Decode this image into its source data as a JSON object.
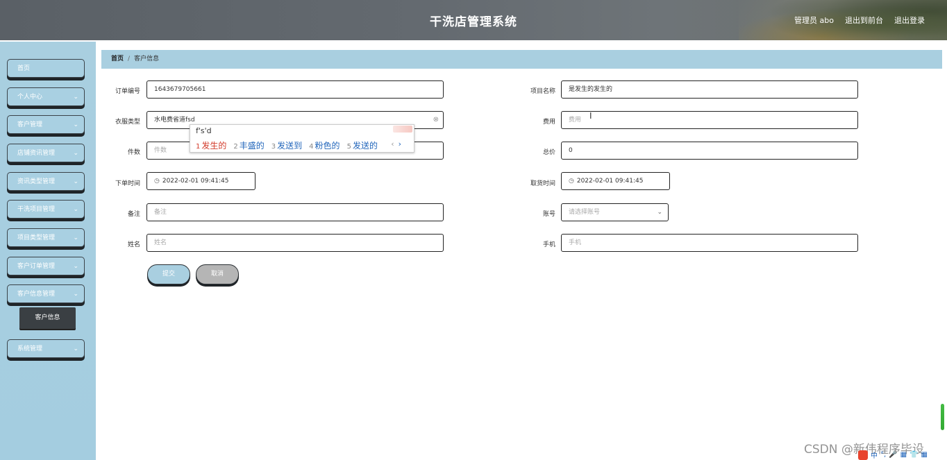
{
  "header": {
    "title": "干洗店管理系统",
    "user_label": "管理员 abo",
    "back_to_front": "退出到前台",
    "logout": "退出登录"
  },
  "sidebar": {
    "items": [
      {
        "label": "首页",
        "has_chevron": false
      },
      {
        "label": "个人中心",
        "has_chevron": true
      },
      {
        "label": "客户管理",
        "has_chevron": true
      },
      {
        "label": "店铺资讯管理",
        "has_chevron": true
      },
      {
        "label": "资讯类型管理",
        "has_chevron": true
      },
      {
        "label": "干洗项目管理",
        "has_chevron": true
      },
      {
        "label": "项目类型管理",
        "has_chevron": true
      },
      {
        "label": "客户订单管理",
        "has_chevron": true
      },
      {
        "label": "客户信息管理",
        "has_chevron": true
      },
      {
        "label": "系统管理",
        "has_chevron": true
      }
    ],
    "sub_active": "客户信息",
    "chevron_glyph": "⌄"
  },
  "breadcrumb": {
    "home": "首页",
    "separator": "/",
    "current": "客户信息"
  },
  "form": {
    "order_no": {
      "label": "订单编号",
      "value": "1643679705661"
    },
    "project_name": {
      "label": "项目名称",
      "value": "是发生的发生的"
    },
    "clothes_type": {
      "label": "衣服类型",
      "value": "水电费省道fsd"
    },
    "fee": {
      "label": "费用",
      "placeholder": "费用"
    },
    "count": {
      "label": "件数",
      "placeholder": "件数"
    },
    "total": {
      "label": "总价",
      "value": "0"
    },
    "order_time": {
      "label": "下单时间",
      "value": "2022-02-01 09:41:45"
    },
    "pickup_time": {
      "label": "取货时间",
      "value": "2022-02-01 09:41:45"
    },
    "remark": {
      "label": "备注",
      "placeholder": "备注"
    },
    "account": {
      "label": "账号",
      "placeholder": "请选择账号"
    },
    "name": {
      "label": "姓名",
      "placeholder": "姓名"
    },
    "phone": {
      "label": "手机",
      "placeholder": "手机"
    },
    "submit_label": "提交",
    "cancel_label": "取消"
  },
  "ime": {
    "composition": "f's'd",
    "candidates": [
      {
        "n": "1",
        "text": "发生的"
      },
      {
        "n": "2",
        "text": "丰盛的"
      },
      {
        "n": "3",
        "text": "发送到"
      },
      {
        "n": "4",
        "text": "粉色的"
      },
      {
        "n": "5",
        "text": "发送的"
      }
    ],
    "prev": "‹",
    "next": "›"
  },
  "watermark": "CSDN @新伟程序毕设",
  "tray": {
    "items": [
      "中",
      "°,",
      "🎤",
      "▦",
      "👕",
      "▦"
    ]
  },
  "colors": {
    "accent": "#a9cfe0",
    "header": "#646a70",
    "ime_first": "#d23a2a",
    "ime_cand": "#2266bb"
  }
}
